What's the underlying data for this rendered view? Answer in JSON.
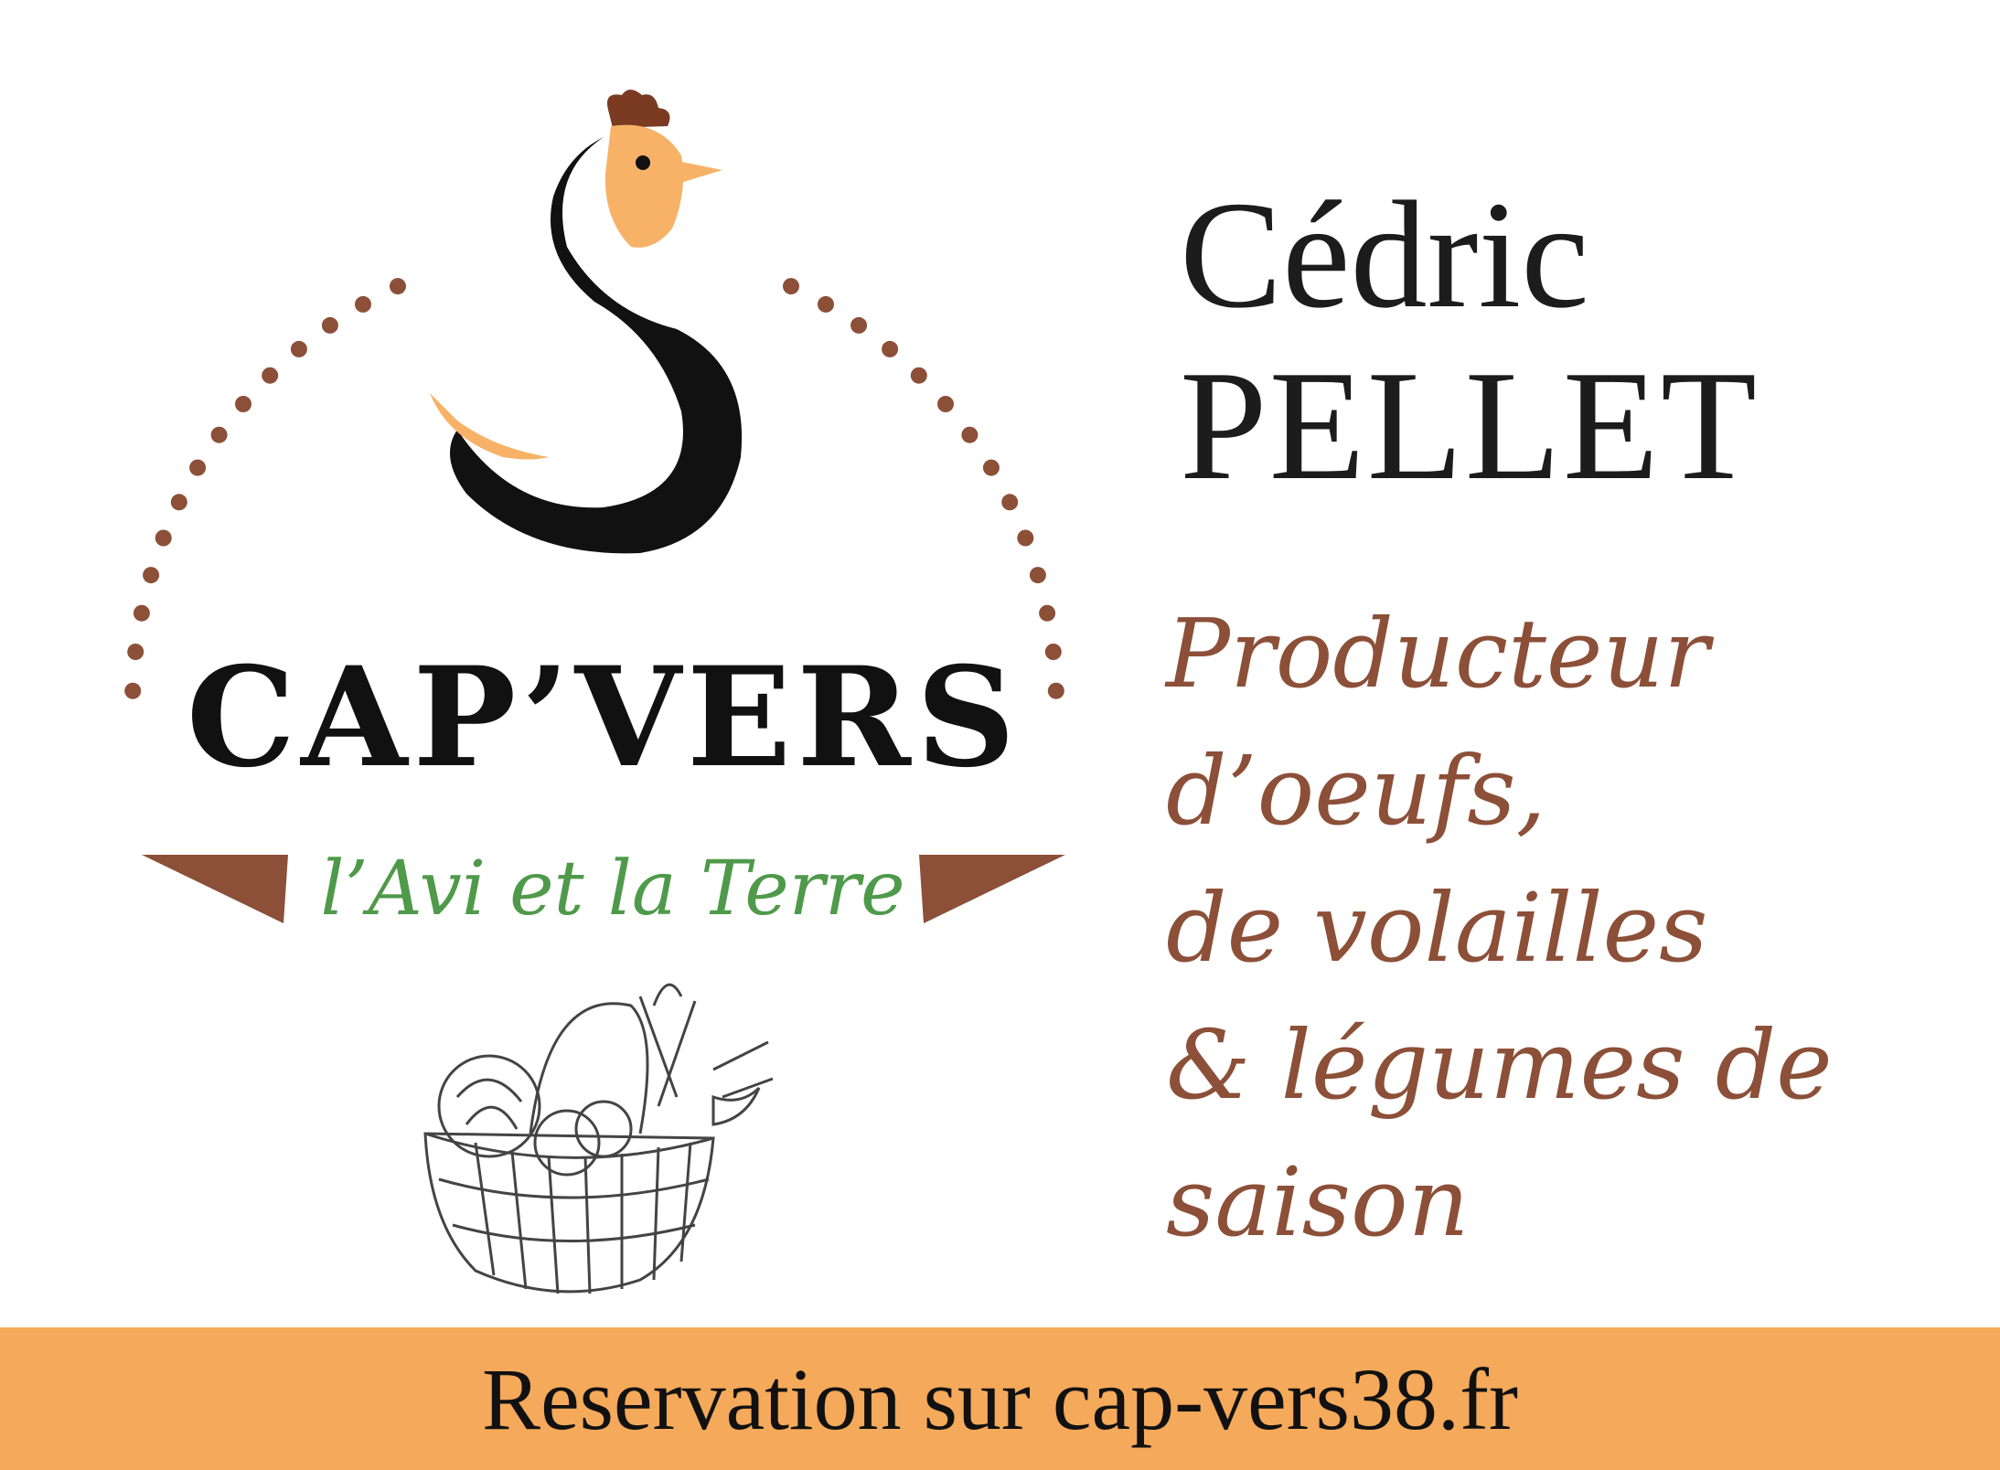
{
  "logo": {
    "brand": "CAP’VERS",
    "tagline": "l’Avi et la Terre",
    "icons": [
      "rooster-icon",
      "vegetable-basket-icon"
    ]
  },
  "producer": {
    "first_name": "Cédric",
    "last_name": "PELLET",
    "description_lines": [
      "Producteur",
      "d’oeufs,",
      "de volailles",
      "& légumes de",
      "saison"
    ]
  },
  "footer": {
    "text": "Reservation sur cap-vers38.fr"
  },
  "colors": {
    "brown": "#8c4f38",
    "green": "#4f9a4a",
    "orange": "#f5a95a",
    "rooster_head": "#f7b267",
    "black": "#111111"
  }
}
